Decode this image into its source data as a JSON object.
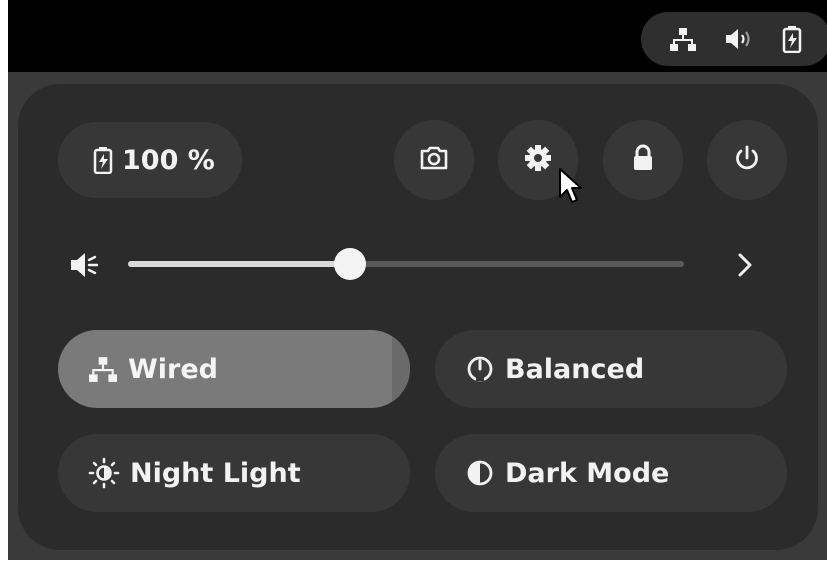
{
  "topbar": {
    "tray_icons": [
      "network-wired-icon",
      "volume-icon",
      "battery-charging-icon"
    ]
  },
  "battery": {
    "label": "100 %",
    "level_percent": 100
  },
  "actions": [
    "screenshot-icon",
    "settings-icon",
    "lock-icon",
    "power-icon"
  ],
  "volume": {
    "level_percent": 40
  },
  "toggles": {
    "wired": {
      "label": "Wired",
      "active": true
    },
    "power_mode": {
      "label": "Balanced"
    },
    "night_light": {
      "label": "Night Light"
    },
    "dark_mode": {
      "label": "Dark Mode"
    }
  },
  "colors": {
    "active_toggle": "#7a7a7a",
    "inactive_toggle": "#373737",
    "panel": "#2b2b2b",
    "topbar": "#000000"
  }
}
